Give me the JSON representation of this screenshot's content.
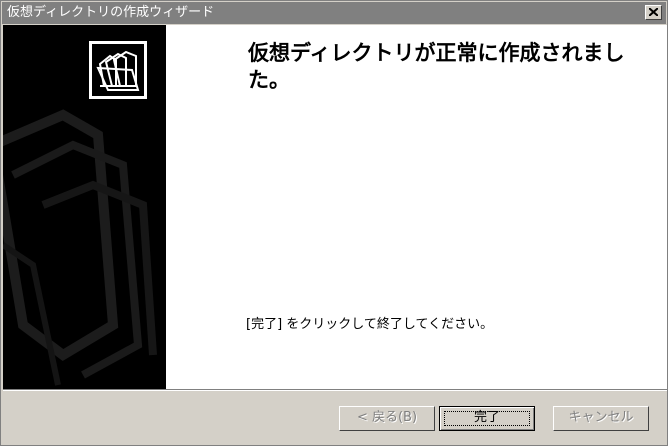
{
  "window": {
    "title": "仮想ディレクトリの作成ウィザード"
  },
  "icons": {
    "close": "close-icon",
    "wizard": "folder-wizard-icon"
  },
  "main": {
    "heading": "仮想ディレクトリが正常に作成されました。",
    "instruction": "[完了] をクリックして終了してください。"
  },
  "buttons": {
    "back": {
      "label": "< 戻る(B)",
      "enabled": false
    },
    "finish": {
      "label": "完了",
      "enabled": true,
      "default": true
    },
    "cancel": {
      "label": "キャンセル",
      "enabled": false
    }
  },
  "colors": {
    "titlebar": "#808080",
    "sidebar": "#000000",
    "dialog": "#d4d0c8"
  }
}
